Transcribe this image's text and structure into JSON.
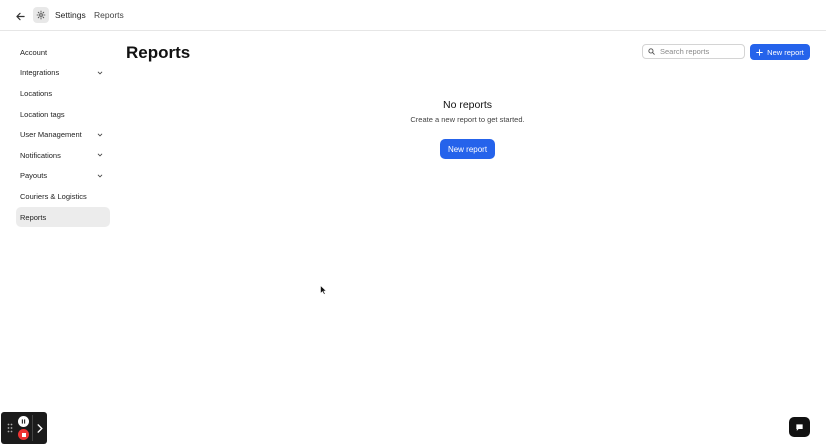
{
  "header": {
    "breadcrumb_settings": "Settings",
    "breadcrumb_current": "Reports",
    "icons": {
      "back": "arrow-left-icon",
      "settings": "gear-icon"
    }
  },
  "sidebar": {
    "items": [
      {
        "label": "Account",
        "expandable": false,
        "active": false
      },
      {
        "label": "Integrations",
        "expandable": true,
        "active": false
      },
      {
        "label": "Locations",
        "expandable": false,
        "active": false
      },
      {
        "label": "Location tags",
        "expandable": false,
        "active": false
      },
      {
        "label": "User Management",
        "expandable": true,
        "active": false
      },
      {
        "label": "Notifications",
        "expandable": true,
        "active": false
      },
      {
        "label": "Payouts",
        "expandable": true,
        "active": false
      },
      {
        "label": "Couriers & Logistics",
        "expandable": false,
        "active": false
      },
      {
        "label": "Reports",
        "expandable": false,
        "active": true
      }
    ]
  },
  "main": {
    "title": "Reports",
    "search_placeholder": "Search reports",
    "new_report_label": "New report",
    "empty_state": {
      "title": "No reports",
      "subtitle": "Create a new report to get started.",
      "button_label": "New report"
    }
  },
  "colors": {
    "accent": "#2563eb",
    "active_item_bg": "#ececec",
    "recorder_bg": "#1b1b1b",
    "record_red": "#ee3333"
  }
}
